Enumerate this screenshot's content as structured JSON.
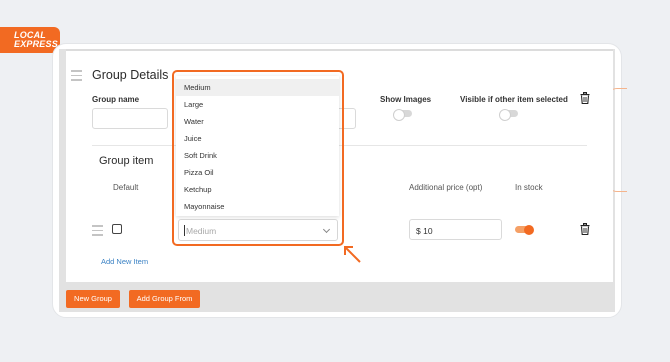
{
  "brand": {
    "logo_line1": "LOCAL",
    "logo_line2": "EXPRESS",
    "accent": "#f26a22"
  },
  "group": {
    "title": "Group Details",
    "group_name_label": "Group name",
    "show_images_label": "Show Images",
    "show_images_on": false,
    "visible_label": "Visible if other item selected",
    "visible_on": false
  },
  "item_section": {
    "title": "Group item",
    "col_default": "Default",
    "col_price": "Additional price (opt)",
    "col_stock": "In stock",
    "row": {
      "default_checked": false,
      "option_value": "Medium",
      "price": "$ 10",
      "in_stock_on": true
    },
    "add_new_item": "Add New Item"
  },
  "dropdown": {
    "options": [
      "Medium",
      "Large",
      "Water",
      "Juice",
      "Soft Drink",
      "Pizza Oil",
      "Ketchup",
      "Mayonnaise"
    ],
    "selected": "Medium"
  },
  "buttons": {
    "new_group": "New Group",
    "add_group_from": "Add Group From"
  },
  "icons": [
    "drag-handle-icon",
    "trash-icon",
    "chevron-down-icon",
    "arrow-pointer-icon"
  ]
}
